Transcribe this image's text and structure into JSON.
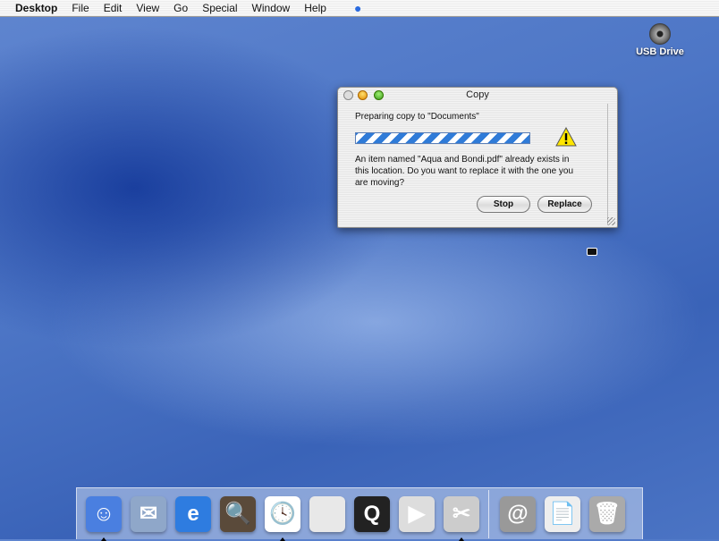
{
  "menubar": {
    "app": "Desktop",
    "items": [
      "File",
      "Edit",
      "View",
      "Go",
      "Special",
      "Window",
      "Help"
    ]
  },
  "desktop": {
    "usb_label": "USB Drive"
  },
  "dialog": {
    "title": "Copy",
    "status": "Preparing copy to \"Documents\"",
    "message": "An item named \"Aqua and Bondi.pdf\" already exists in this location. Do you want to replace it with the one you are moving?",
    "stop": "Stop",
    "replace": "Replace",
    "progress": "indeterminate"
  },
  "dock": {
    "apps": [
      {
        "name": "finder",
        "glyph": "☺",
        "running": true,
        "bg": "#4a7fe0"
      },
      {
        "name": "mail",
        "glyph": "✉",
        "running": false,
        "bg": "#8fa7c9"
      },
      {
        "name": "internet-explorer",
        "glyph": "e",
        "running": false,
        "bg": "#2e7ce0"
      },
      {
        "name": "sherlock",
        "glyph": "🔍",
        "running": false,
        "bg": "#5a4a3a"
      },
      {
        "name": "clock",
        "glyph": "🕓",
        "running": true,
        "bg": "#ffffff"
      },
      {
        "name": "system-preferences",
        "glyph": "",
        "running": false,
        "bg": "#e8e8e8"
      },
      {
        "name": "quicktime",
        "glyph": "Q",
        "running": false,
        "bg": "#222"
      },
      {
        "name": "itunes",
        "glyph": "▶",
        "running": false,
        "bg": "#ddd"
      },
      {
        "name": "grab",
        "glyph": "✂",
        "running": true,
        "bg": "#ccc"
      }
    ],
    "docs": [
      {
        "name": "internet-location",
        "glyph": "@",
        "bg": "#999"
      },
      {
        "name": "read-me",
        "glyph": "📄",
        "bg": "#eee"
      },
      {
        "name": "trash",
        "glyph": "🗑",
        "bg": "#aaa"
      }
    ]
  }
}
